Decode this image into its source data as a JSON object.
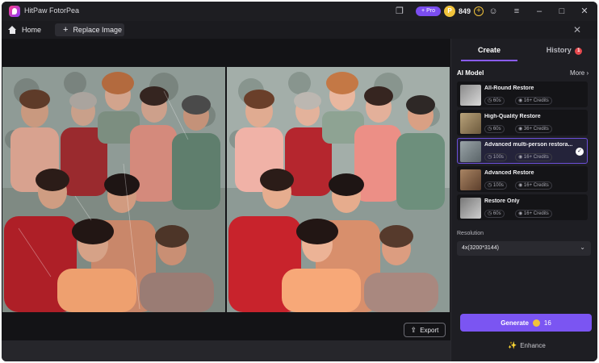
{
  "app": {
    "title": "HitPaw FotorPea"
  },
  "titlebar": {
    "pro_label": "+ Pro",
    "credits": "849",
    "icons": [
      "feedback-icon",
      "coin-icon",
      "add-credits-icon",
      "account-icon",
      "menu-icon",
      "minimize-icon",
      "maximize-icon",
      "close-icon"
    ]
  },
  "tabs": {
    "home": "Home",
    "replace": "Replace Image"
  },
  "canvas": {
    "export_label": "Export"
  },
  "panel": {
    "tabs": {
      "create": "Create",
      "history": "History",
      "history_badge": "1"
    },
    "ai_model_title": "AI Model",
    "more_label": "More",
    "models": [
      {
        "name": "All-Round Restore",
        "time": "60s",
        "credits": "16+ Credits",
        "selected": false
      },
      {
        "name": "High-Quality Restore",
        "time": "60s",
        "credits": "36+ Credits",
        "selected": false
      },
      {
        "name": "Advanced multi-person restora...",
        "time": "100s",
        "credits": "16+ Credits",
        "selected": true
      },
      {
        "name": "Advanced Restore",
        "time": "100s",
        "credits": "16+ Credits",
        "selected": false
      },
      {
        "name": "Restore Only",
        "time": "60s",
        "credits": "16+ Credits",
        "selected": false
      }
    ],
    "resolution_label": "Resolution",
    "resolution_value": "4x(3200*3144)",
    "generate_label": "Generate",
    "generate_cost": "16",
    "enhance_label": "Enhance"
  },
  "colors": {
    "accent": "#7b55f2",
    "coin": "#f1c33b",
    "panel_bg": "#1e1e23",
    "window_bg": "#1c1c20"
  }
}
